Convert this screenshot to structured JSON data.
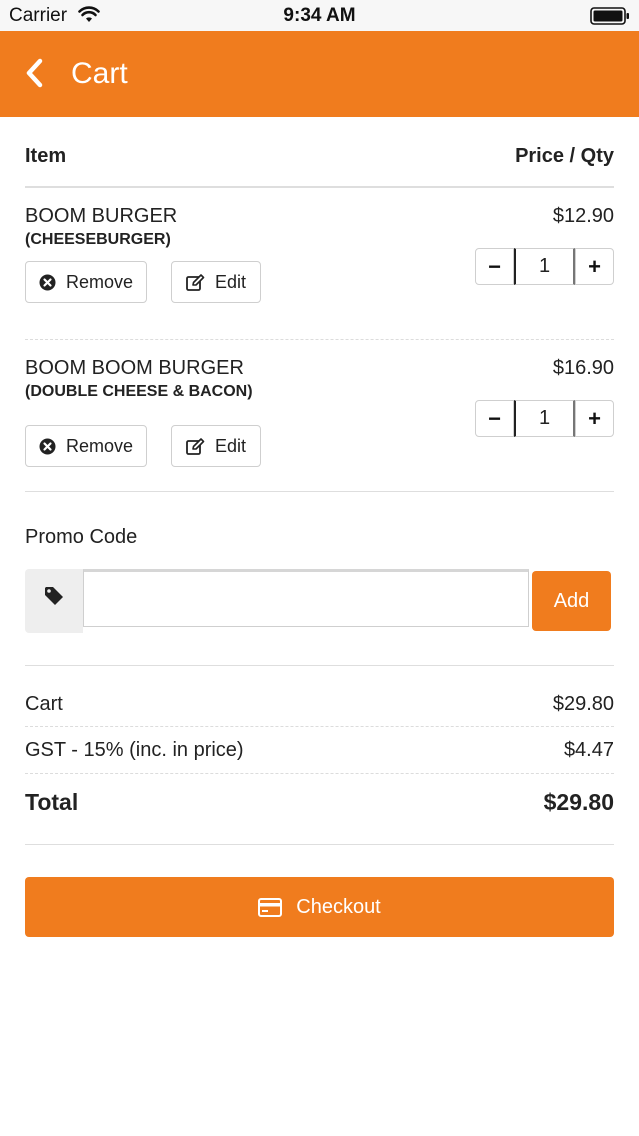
{
  "status_bar": {
    "carrier": "Carrier",
    "time": "9:34 AM"
  },
  "nav": {
    "title": "Cart",
    "back_icon": "chevron-left-icon"
  },
  "colors": {
    "accent": "#f07c1e",
    "nav_text": "#ffffff",
    "divider": "#dedede"
  },
  "table_header": {
    "item": "Item",
    "price_qty": "Price / Qty"
  },
  "items": [
    {
      "name": "BOOM BURGER",
      "variant": "(CHEESEBURGER)",
      "price": "$12.90",
      "qty": "1",
      "remove_label": "Remove",
      "edit_label": "Edit"
    },
    {
      "name": "BOOM BOOM BURGER",
      "variant": "(DOUBLE CHEESE & BACON)",
      "price": "$16.90",
      "qty": "1",
      "remove_label": "Remove",
      "edit_label": "Edit"
    }
  ],
  "promo": {
    "label": "Promo Code",
    "value": "",
    "add_label": "Add",
    "icon": "tag-icon"
  },
  "summary": {
    "cart_label": "Cart",
    "cart_value": "$29.80",
    "gst_label": "GST - 15% (inc. in price)",
    "gst_value": "$4.47",
    "total_label": "Total",
    "total_value": "$29.80"
  },
  "checkout": {
    "label": "Checkout",
    "icon": "credit-card-icon"
  }
}
